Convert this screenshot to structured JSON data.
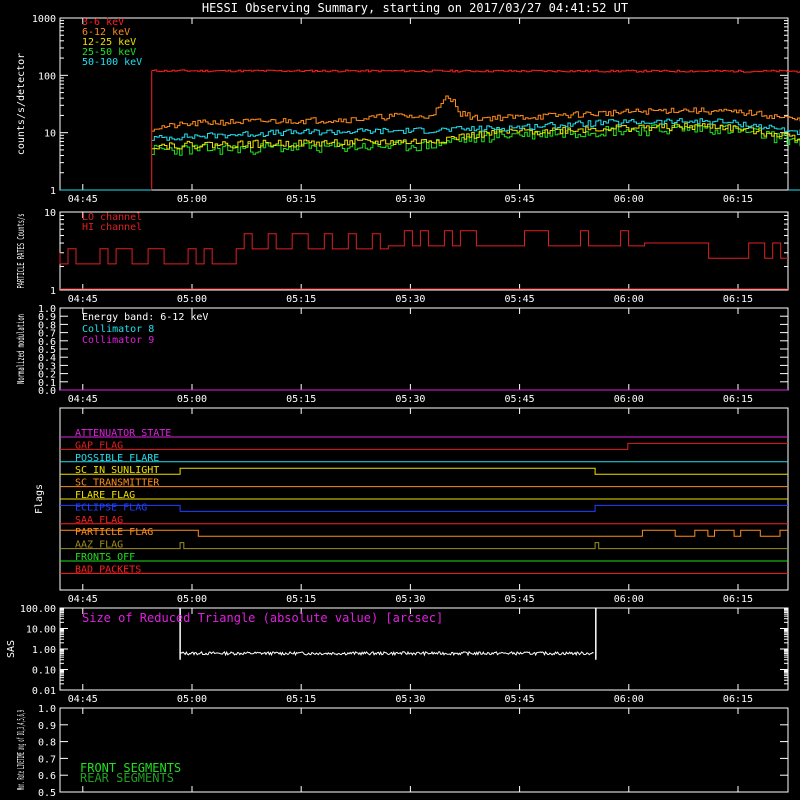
{
  "title": "HESSI Observing Summary, starting on 2017/03/27 04:41:52 UT",
  "time_ticks": [
    "04:45",
    "05:00",
    "05:15",
    "05:30",
    "05:45",
    "06:00",
    "06:15"
  ],
  "colors": {
    "red": "#ff2020",
    "orange": "#ff8c1a",
    "yellow": "#f0e000",
    "green": "#20e020",
    "cyan": "#20e0f0",
    "magenta": "#e020e0",
    "blue": "#2040ff",
    "olive": "#a09020",
    "darkgreen": "#20a020",
    "white": "#ffffff",
    "dkred": "#e02020"
  },
  "chart_data": [
    {
      "type": "line",
      "panel": "count-rates",
      "ylabel": "counts/s/detector",
      "yscale": "log",
      "ylim": [
        1,
        1000
      ],
      "y_ticks": [
        "1",
        "10",
        "100",
        "1000"
      ],
      "x_range_minutes": [
        0,
        100
      ],
      "series": [
        {
          "name": "3-6 keV",
          "color": "red",
          "points": [
            [
              0,
              1
            ],
            [
              12.6,
              1
            ],
            [
              12.6,
              120
            ],
            [
              30,
              118
            ],
            [
              50,
              122
            ],
            [
              70,
              120
            ],
            [
              90,
              118
            ],
            [
              103,
              118
            ],
            [
              103,
              1
            ],
            [
              100,
              1
            ]
          ]
        },
        {
          "name": "6-12 keV",
          "color": "orange",
          "points": [
            [
              12.6,
              12
            ],
            [
              20,
              15
            ],
            [
              30,
              16
            ],
            [
              40,
              17
            ],
            [
              47,
              20
            ],
            [
              50,
              18
            ],
            [
              52,
              26
            ],
            [
              53,
              40
            ],
            [
              54,
              35
            ],
            [
              55,
              22
            ],
            [
              57,
              18
            ],
            [
              65,
              19
            ],
            [
              75,
              22
            ],
            [
              85,
              25
            ],
            [
              95,
              22
            ],
            [
              102,
              16
            ]
          ]
        },
        {
          "name": "12-25 keV",
          "color": "yellow",
          "points": [
            [
              12.6,
              6
            ],
            [
              30,
              6.5
            ],
            [
              50,
              7
            ],
            [
              60,
              10
            ],
            [
              75,
              12
            ],
            [
              90,
              13
            ],
            [
              102,
              8
            ]
          ]
        },
        {
          "name": "25-50 keV",
          "color": "green",
          "points": [
            [
              12.6,
              5
            ],
            [
              30,
              5.5
            ],
            [
              50,
              6
            ],
            [
              60,
              9
            ],
            [
              75,
              11
            ],
            [
              90,
              12
            ],
            [
              102,
              7
            ]
          ]
        },
        {
          "name": "50-100 keV",
          "color": "cyan",
          "points": [
            [
              12.6,
              8
            ],
            [
              30,
              10
            ],
            [
              50,
              11
            ],
            [
              60,
              12
            ],
            [
              75,
              15
            ],
            [
              90,
              16
            ],
            [
              102,
              10
            ]
          ]
        }
      ]
    },
    {
      "type": "line",
      "panel": "particle-rates",
      "ylabel": "PARTICLE RATES Counts/s",
      "yscale": "log",
      "ylim": [
        1,
        10
      ],
      "y_ticks": [
        "1",
        "10"
      ],
      "series": [
        {
          "name": "LO channel",
          "color": "red",
          "points": [
            [
              0,
              3
            ],
            [
              100,
              3
            ]
          ]
        },
        {
          "name": "HI channel",
          "color": "red",
          "points": [
            [
              0,
              2.6
            ],
            [
              25,
              3.2
            ],
            [
              26,
              4.5
            ],
            [
              45,
              4.5
            ],
            [
              70,
              5
            ],
            [
              90,
              4
            ],
            [
              98,
              3
            ],
            [
              100,
              3
            ]
          ]
        }
      ]
    },
    {
      "type": "line",
      "panel": "modulation",
      "ylabel": "Normalized modulation",
      "ylim": [
        0,
        1
      ],
      "y_ticks": [
        "0.0",
        "0.1",
        "0.2",
        "0.3",
        "0.4",
        "0.5",
        "0.6",
        "0.7",
        "0.8",
        "0.9",
        "1.0"
      ],
      "annotation": "Energy band: 6-12 keV",
      "series": [
        {
          "name": "Collimator 8",
          "color": "cyan",
          "points": []
        },
        {
          "name": "Collimator 9",
          "color": "magenta",
          "points": [
            [
              0,
              0
            ],
            [
              100,
              0
            ]
          ]
        }
      ]
    },
    {
      "type": "line",
      "panel": "flags",
      "ylabel": "Flags",
      "series": [
        {
          "name": "ATTENUATOR STATE",
          "color": "magenta",
          "points": [
            [
              0,
              0
            ],
            [
              100,
              0
            ]
          ]
        },
        {
          "name": "GAP FLAG",
          "color": "dkred",
          "points": [
            [
              0,
              0
            ],
            [
              78,
              0
            ],
            [
              78,
              1
            ],
            [
              100,
              1
            ]
          ]
        },
        {
          "name": "POSSIBLE FLARE",
          "color": "cyan",
          "points": [
            [
              0,
              0
            ],
            [
              100,
              0
            ]
          ]
        },
        {
          "name": "SC IN SUNLIGHT",
          "color": "yellow",
          "points": [
            [
              0,
              0
            ],
            [
              16.5,
              0
            ],
            [
              16.5,
              1
            ],
            [
              73.5,
              1
            ],
            [
              73.5,
              0
            ],
            [
              100,
              0
            ]
          ]
        },
        {
          "name": "SC TRANSMITTER",
          "color": "orange",
          "points": [
            [
              0,
              0
            ],
            [
              100,
              0
            ]
          ]
        },
        {
          "name": "FLARE FLAG",
          "color": "yellow",
          "points": [
            [
              0,
              0
            ],
            [
              100,
              0
            ]
          ]
        },
        {
          "name": "ECLIPSE FLAG",
          "color": "blue",
          "points": [
            [
              0,
              1
            ],
            [
              16.5,
              1
            ],
            [
              16.5,
              0
            ],
            [
              73.5,
              0
            ],
            [
              73.5,
              1
            ],
            [
              100,
              1
            ]
          ]
        },
        {
          "name": "SAA FLAG",
          "color": "red",
          "points": [
            [
              0,
              0
            ],
            [
              100,
              0
            ]
          ]
        },
        {
          "name": "PARTICLE FLAG",
          "color": "orange",
          "points": [
            [
              0,
              1
            ],
            [
              19,
              1
            ],
            [
              19,
              0
            ],
            [
              80,
              0
            ],
            [
              80,
              1
            ],
            [
              100,
              1
            ]
          ]
        },
        {
          "name": "AAZ FLAG",
          "color": "olive",
          "points": [
            [
              0,
              0
            ],
            [
              16.5,
              0
            ],
            [
              16.5,
              1
            ],
            [
              17,
              1
            ],
            [
              17,
              0
            ],
            [
              73.5,
              0
            ],
            [
              73.5,
              1
            ],
            [
              74,
              1
            ],
            [
              74,
              0
            ],
            [
              100,
              0
            ]
          ]
        },
        {
          "name": "FRONTS OFF",
          "color": "green",
          "points": [
            [
              0,
              0
            ],
            [
              100,
              0
            ]
          ]
        },
        {
          "name": "BAD PACKETS",
          "color": "red",
          "points": [
            [
              0,
              0
            ],
            [
              100,
              0
            ]
          ]
        }
      ]
    },
    {
      "type": "line",
      "panel": "sas",
      "ylabel": "SAS",
      "yscale": "log",
      "ylim": [
        0.01,
        100
      ],
      "y_ticks": [
        "0.01",
        "0.10",
        "1.00",
        "10.00",
        "100.00"
      ],
      "annotation": "Size of Reduced Triangle (absolute value) [arcsec]",
      "series": [
        {
          "name": "SAS",
          "color": "white",
          "points": [
            [
              16.5,
              0.3
            ],
            [
              16.5,
              100
            ],
            [
              17.5,
              0.6
            ],
            [
              40,
              0.6
            ],
            [
              60,
              0.65
            ],
            [
              73,
              0.6
            ],
            [
              73.5,
              100
            ],
            [
              74,
              0.3
            ]
          ]
        }
      ]
    },
    {
      "type": "line",
      "panel": "livetime",
      "ylabel": "Mon. Rate LIVETIME avg of D1,3,4,5,6,9",
      "ylim": [
        0.5,
        1.0
      ],
      "y_ticks": [
        "0.5",
        "0.6",
        "0.7",
        "0.8",
        "0.9",
        "1.0"
      ],
      "series": [
        {
          "name": "FRONT SEGMENTS",
          "color": "green",
          "points": []
        },
        {
          "name": "REAR SEGMENTS",
          "color": "darkgreen",
          "points": []
        }
      ]
    }
  ]
}
